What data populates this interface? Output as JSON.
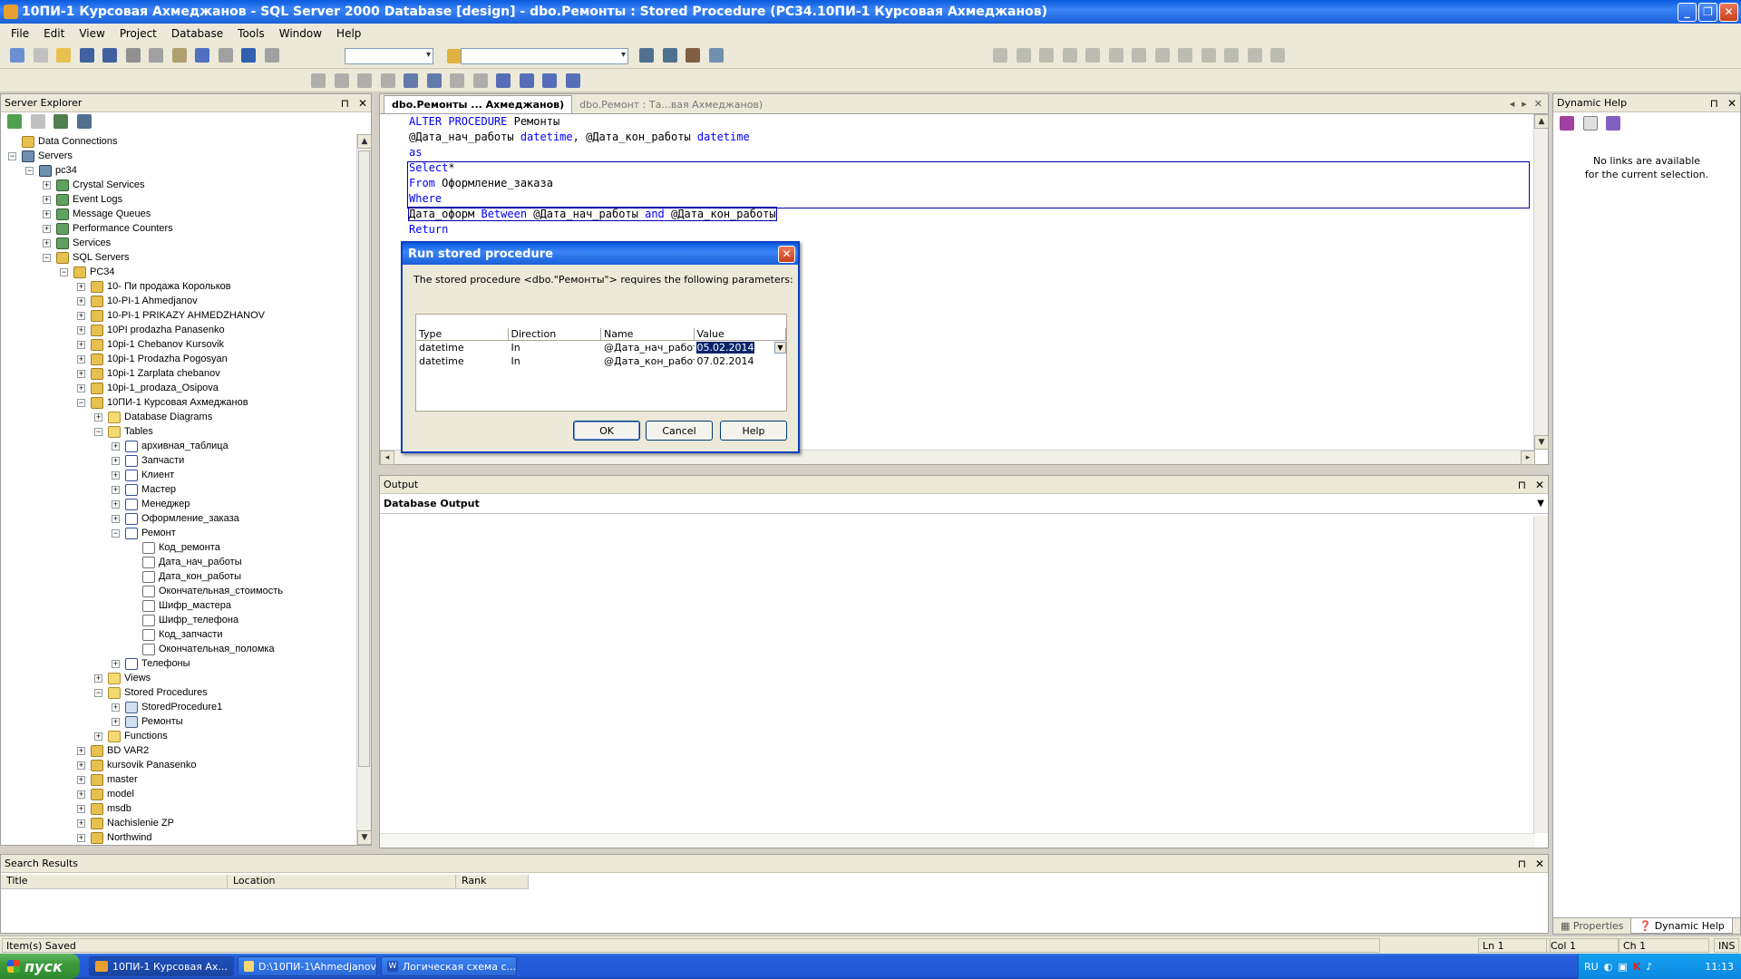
{
  "window": {
    "title": "10ПИ-1 Курсовая Ахмеджанов - SQL Server 2000 Database [design] - dbo.Ремонты : Stored Procedure (PC34.10ПИ-1 Курсовая Ахмеджанов)"
  },
  "menu": [
    "File",
    "Edit",
    "View",
    "Project",
    "Database",
    "Tools",
    "Window",
    "Help"
  ],
  "server_explorer": {
    "title": "Server Explorer",
    "tree": [
      {
        "label": "Data Connections",
        "depth": 0,
        "icon": "db",
        "exp": ""
      },
      {
        "label": "Servers",
        "depth": 0,
        "icon": "server",
        "exp": "-"
      },
      {
        "label": "pc34",
        "depth": 1,
        "icon": "server",
        "exp": "-"
      },
      {
        "label": "Crystal Services",
        "depth": 2,
        "icon": "svc",
        "exp": "+"
      },
      {
        "label": "Event Logs",
        "depth": 2,
        "icon": "svc",
        "exp": "+"
      },
      {
        "label": "Message Queues",
        "depth": 2,
        "icon": "svc",
        "exp": "+"
      },
      {
        "label": "Performance Counters",
        "depth": 2,
        "icon": "svc",
        "exp": "+"
      },
      {
        "label": "Services",
        "depth": 2,
        "icon": "svc",
        "exp": "+"
      },
      {
        "label": "SQL Servers",
        "depth": 2,
        "icon": "db",
        "exp": "-"
      },
      {
        "label": "PC34",
        "depth": 3,
        "icon": "db",
        "exp": "-"
      },
      {
        "label": "10- Пи продажа Корольков",
        "depth": 4,
        "icon": "db",
        "exp": "+"
      },
      {
        "label": "10-PI-1 Ahmedjanov",
        "depth": 4,
        "icon": "db",
        "exp": "+"
      },
      {
        "label": "10-PI-1 PRIKAZY AHMEDZHANOV",
        "depth": 4,
        "icon": "db",
        "exp": "+"
      },
      {
        "label": "10PI prodazha Panasenko",
        "depth": 4,
        "icon": "db",
        "exp": "+"
      },
      {
        "label": "10pi-1 Chebanov Kursovik",
        "depth": 4,
        "icon": "db",
        "exp": "+"
      },
      {
        "label": "10pi-1 Prodazha Pogosyan",
        "depth": 4,
        "icon": "db",
        "exp": "+"
      },
      {
        "label": "10pi-1 Zarplata chebanov",
        "depth": 4,
        "icon": "db",
        "exp": "+"
      },
      {
        "label": "10pi-1_prodaza_Osipova",
        "depth": 4,
        "icon": "db",
        "exp": "+"
      },
      {
        "label": "10ПИ-1 Курсовая Ахмеджанов",
        "depth": 4,
        "icon": "db",
        "exp": "-"
      },
      {
        "label": "Database Diagrams",
        "depth": 5,
        "icon": "folder",
        "exp": "+"
      },
      {
        "label": "Tables",
        "depth": 5,
        "icon": "folder",
        "exp": "-"
      },
      {
        "label": "архивная_таблица",
        "depth": 6,
        "icon": "table",
        "exp": "+"
      },
      {
        "label": "Запчасти",
        "depth": 6,
        "icon": "table",
        "exp": "+"
      },
      {
        "label": "Клиент",
        "depth": 6,
        "icon": "table",
        "exp": "+"
      },
      {
        "label": "Мастер",
        "depth": 6,
        "icon": "table",
        "exp": "+"
      },
      {
        "label": "Менеджер",
        "depth": 6,
        "icon": "table",
        "exp": "+"
      },
      {
        "label": "Оформление_заказа",
        "depth": 6,
        "icon": "table",
        "exp": "+"
      },
      {
        "label": "Ремонт",
        "depth": 6,
        "icon": "table",
        "exp": "-"
      },
      {
        "label": "Код_ремонта",
        "depth": 7,
        "icon": "col",
        "exp": ""
      },
      {
        "label": "Дата_нач_работы",
        "depth": 7,
        "icon": "col",
        "exp": ""
      },
      {
        "label": "Дата_кон_работы",
        "depth": 7,
        "icon": "col",
        "exp": ""
      },
      {
        "label": "Окончательная_стоимость",
        "depth": 7,
        "icon": "col",
        "exp": ""
      },
      {
        "label": "Шифр_мастера",
        "depth": 7,
        "icon": "col",
        "exp": ""
      },
      {
        "label": "Шифр_телефона",
        "depth": 7,
        "icon": "col",
        "exp": ""
      },
      {
        "label": "Код_запчасти",
        "depth": 7,
        "icon": "col",
        "exp": ""
      },
      {
        "label": "Окончательная_поломка",
        "depth": 7,
        "icon": "col",
        "exp": ""
      },
      {
        "label": "Телефоны",
        "depth": 6,
        "icon": "table",
        "exp": "+"
      },
      {
        "label": "Views",
        "depth": 5,
        "icon": "folder",
        "exp": "+"
      },
      {
        "label": "Stored Procedures",
        "depth": 5,
        "icon": "folder",
        "exp": "-"
      },
      {
        "label": "StoredProcedure1",
        "depth": 6,
        "icon": "proc",
        "exp": "+"
      },
      {
        "label": "Ремонты",
        "depth": 6,
        "icon": "proc",
        "exp": "+"
      },
      {
        "label": "Functions",
        "depth": 5,
        "icon": "folder",
        "exp": "+"
      },
      {
        "label": "BD VAR2",
        "depth": 4,
        "icon": "db",
        "exp": "+"
      },
      {
        "label": "kursovik Panasenko",
        "depth": 4,
        "icon": "db",
        "exp": "+"
      },
      {
        "label": "master",
        "depth": 4,
        "icon": "db",
        "exp": "+"
      },
      {
        "label": "model",
        "depth": 4,
        "icon": "db",
        "exp": "+"
      },
      {
        "label": "msdb",
        "depth": 4,
        "icon": "db",
        "exp": "+"
      },
      {
        "label": "Nachislenie ZP",
        "depth": 4,
        "icon": "db",
        "exp": "+"
      },
      {
        "label": "Northwind",
        "depth": 4,
        "icon": "db",
        "exp": "+"
      }
    ]
  },
  "editor": {
    "tab_active": "dbo.Ремонты ... Ахмеджанов)",
    "tab_inactive": "dbo.Ремонт : Та...вая Ахмеджанов)",
    "code": {
      "l1_kw": "ALTER PROCEDURE",
      "l1_name": " Ремонты",
      "l2_p1": "@Дата_нач_работы ",
      "l2_t1": "datetime",
      "l2_p2": ", @Дата_кон_работы ",
      "l2_t2": "datetime",
      "l3": "as",
      "l4_kw": "Select",
      "l4_rest": "*",
      "l5_kw": "From",
      "l5_rest": " Оформление_заказа",
      "l6": "Where",
      "l7_a": "Дата_оформ ",
      "l7_kw1": "Between",
      "l7_b": " @Дата_нач_работы ",
      "l7_kw2": "and",
      "l7_c": " @Дата_кон_работы",
      "l8": "Return"
    }
  },
  "dialog": {
    "title": "Run stored procedure",
    "message": "The stored procedure <dbo.\"Ремонты\"> requires the following parameters:",
    "headers": [
      "Type",
      "Direction",
      "Name",
      "Value"
    ],
    "rows": [
      [
        "datetime",
        "In",
        "@Дата_нач_работы",
        "05.02.2014"
      ],
      [
        "datetime",
        "In",
        "@Дата_кон_работы",
        "07.02.2014"
      ]
    ],
    "ok": "OK",
    "cancel": "Cancel",
    "help": "Help"
  },
  "output": {
    "title": "Output",
    "pane": "Database Output"
  },
  "dynamic_help": {
    "title": "Dynamic Help",
    "message_line1": "No links are available",
    "message_line2": "for the current selection.",
    "tab_properties": "Properties",
    "tab_dynamic_help": "Dynamic Help"
  },
  "search_results": {
    "title": "Search Results",
    "cols": [
      "Title",
      "Location",
      "Rank"
    ]
  },
  "status": {
    "message": "Item(s) Saved",
    "ln": "Ln 1",
    "col": "Col 1",
    "ch": "Ch 1",
    "ins": "INS"
  },
  "taskbar": {
    "start": "пуск",
    "items": [
      "10ПИ-1 Курсовая Ах...",
      "D:\\10ПИ-1\\Ahmedjanov",
      "Логическая схема с..."
    ],
    "lang": "RU",
    "clock": "11:13"
  }
}
